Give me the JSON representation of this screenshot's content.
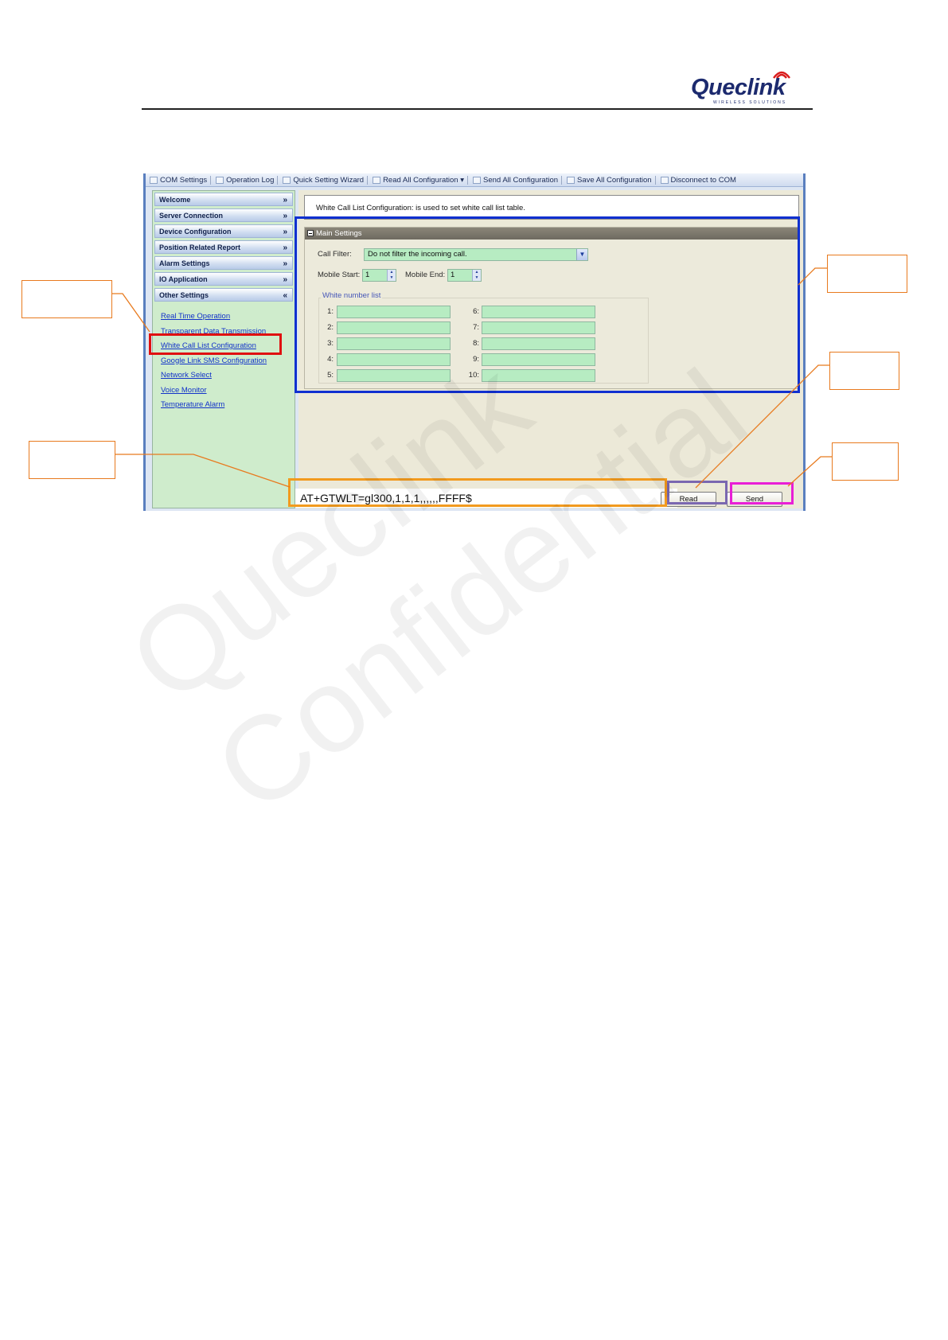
{
  "header": {
    "logo_text": "Queclink",
    "logo_subtext": "WIRELESS SOLUTIONS"
  },
  "watermark": {
    "text": "Queclink\nConfidential"
  },
  "toolbar": {
    "items": [
      {
        "label": "COM Settings",
        "icon": "plug-icon"
      },
      {
        "label": "Operation Log",
        "icon": "log-icon"
      },
      {
        "label": "Quick Setting Wizard",
        "icon": "wizard-icon"
      },
      {
        "label": "Read All Configuration ▾",
        "icon": "read-icon"
      },
      {
        "label": "Send All Configuration",
        "icon": "send-icon"
      },
      {
        "label": "Save All Configuration",
        "icon": "save-icon"
      },
      {
        "label": "Disconnect to COM",
        "icon": "disconnect-icon"
      }
    ]
  },
  "sidebar": {
    "sections": [
      {
        "label": "Welcome",
        "chevron": "»"
      },
      {
        "label": "Server Connection",
        "chevron": "»"
      },
      {
        "label": "Device Configuration",
        "chevron": "»"
      },
      {
        "label": "Position Related Report",
        "chevron": "»"
      },
      {
        "label": "Alarm Settings",
        "chevron": "»"
      },
      {
        "label": "IO Application",
        "chevron": "»"
      },
      {
        "label": "Other Settings",
        "chevron": "«"
      }
    ],
    "links": [
      "Real Time Operation",
      "Transparent Data Transmission",
      "White Call List Configuration",
      "Google Link SMS Configuration",
      "Network Select",
      "Voice Monitor",
      "Temperature Alarm"
    ]
  },
  "content": {
    "description": "White Call List Configuration: is used to set white call list table.",
    "main_settings": {
      "title": "Main Settings",
      "call_filter_label": "Call Filter:",
      "call_filter_value": "Do not filter the incoming call.",
      "mobile_start_label": "Mobile Start:",
      "mobile_start_value": "1",
      "mobile_end_label": "Mobile End:",
      "mobile_end_value": "1",
      "white_list_title": "White number list",
      "white_list_labels": [
        "1:",
        "2:",
        "3:",
        "4:",
        "5:",
        "6:",
        "7:",
        "8:",
        "9:",
        "10:"
      ]
    },
    "command": "AT+GTWLT=gl300,1,1,1,,,,,,FFFF$",
    "read_button": "Read",
    "send_button": "Send"
  },
  "colors": {
    "sidebar_select_highlight": "#e01010",
    "main_settings_highlight": "#1030d0",
    "command_highlight": "#f29a1e",
    "read_highlight": "#7a67b0",
    "send_highlight": "#e81fd6",
    "callout_border": "#e87a1e",
    "field_green": "#b7ecc2"
  }
}
